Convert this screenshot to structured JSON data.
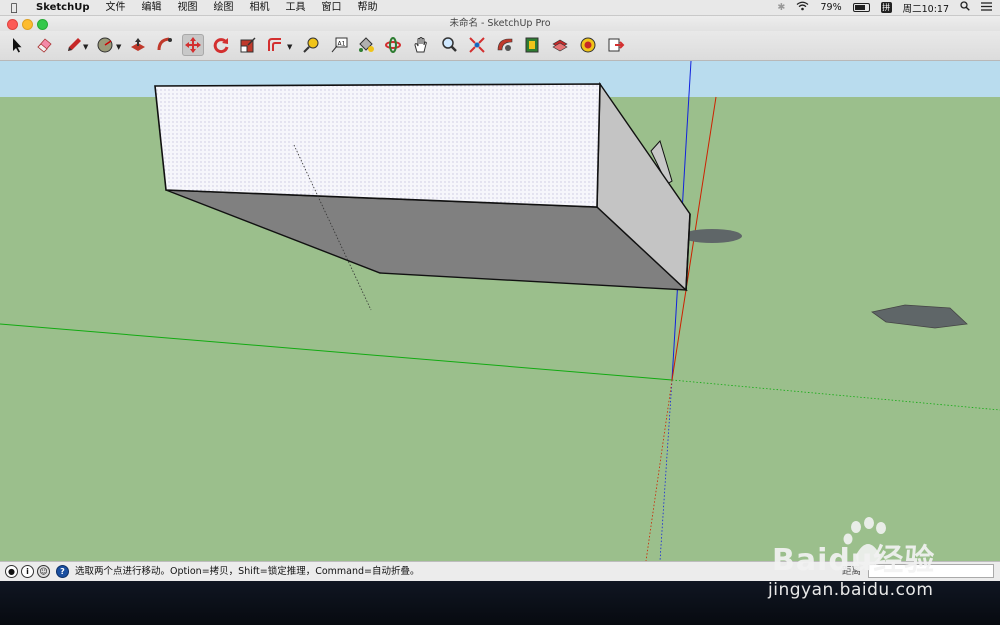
{
  "menubar": {
    "app_name": "SketchUp",
    "items": [
      "文件",
      "编辑",
      "视图",
      "绘图",
      "相机",
      "工具",
      "窗口",
      "帮助"
    ],
    "battery": "79%",
    "clock": "周二10:17",
    "ime": "拼"
  },
  "window": {
    "title": "未命名 - SketchUp Pro"
  },
  "toolbar": {
    "tools": [
      "select",
      "eraser",
      "pencil",
      "circle",
      "push-pull",
      "follow-me",
      "move",
      "rotate",
      "scale",
      "offset",
      "tape-measure",
      "text",
      "paint-bucket",
      "orbit",
      "pan",
      "zoom",
      "zoom-extents",
      "3d-warehouse",
      "extension-warehouse",
      "layout",
      "scenes",
      "send-to-layout"
    ],
    "active_tool": "move"
  },
  "statusbar": {
    "message": "选取两个点进行移动。Option=拷贝，Shift=锁定推理，Command=自动折叠。",
    "measure_label": "距离",
    "measure_value": ""
  },
  "watermark": {
    "brand": "Baidu经验",
    "url": "jingyan.baidu.com"
  },
  "colors": {
    "sky": "#b9dcee",
    "ground": "#9bbf8c",
    "box_top": "#f4f4fa",
    "box_front": "#808080",
    "box_side": "#c4c4c4",
    "axis_red": "#cc2200",
    "axis_green": "#11aa11",
    "axis_blue": "#1122dd"
  }
}
